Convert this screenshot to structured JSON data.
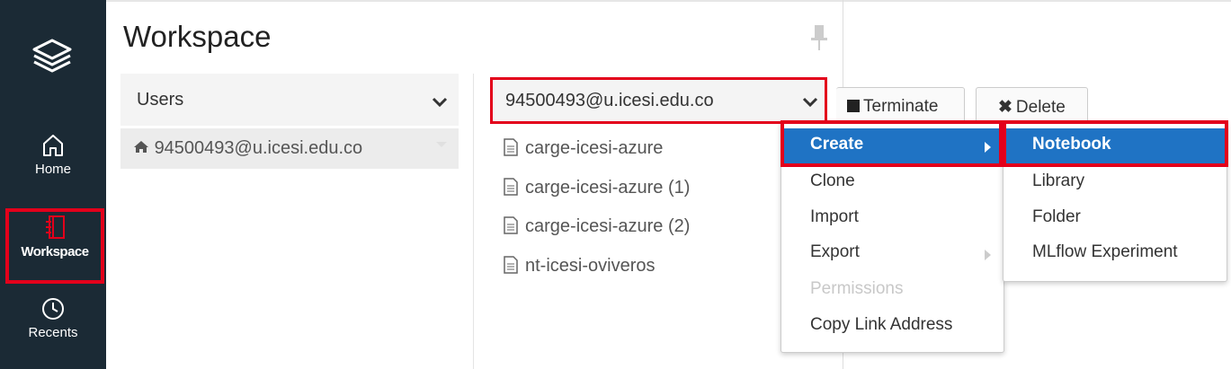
{
  "sidebar": {
    "items": [
      {
        "label": "Home",
        "icon": "home-icon"
      },
      {
        "label": "Workspace",
        "icon": "workspace-icon"
      },
      {
        "label": "Recents",
        "icon": "clock-icon"
      }
    ]
  },
  "header": {
    "title": "Workspace"
  },
  "users_panel": {
    "header": "Users",
    "user": "94500493@u.icesi.edu.co"
  },
  "folder_panel": {
    "header": "94500493@u.icesi.edu.co",
    "files": [
      "carge-icesi-azure",
      "carge-icesi-azure (1)",
      "carge-icesi-azure (2)",
      "nt-icesi-oviveros"
    ]
  },
  "toolbar": {
    "terminate": "Terminate",
    "delete": "Delete"
  },
  "context_menu": {
    "items": [
      "Create",
      "Clone",
      "Import",
      "Export",
      "Permissions",
      "Copy Link Address"
    ]
  },
  "create_submenu": {
    "items": [
      "Notebook",
      "Library",
      "Folder",
      "MLflow Experiment"
    ]
  },
  "colors": {
    "sidebar": "#1b2a35",
    "highlight": "#e3001b",
    "menu_active": "#1f73c4"
  }
}
